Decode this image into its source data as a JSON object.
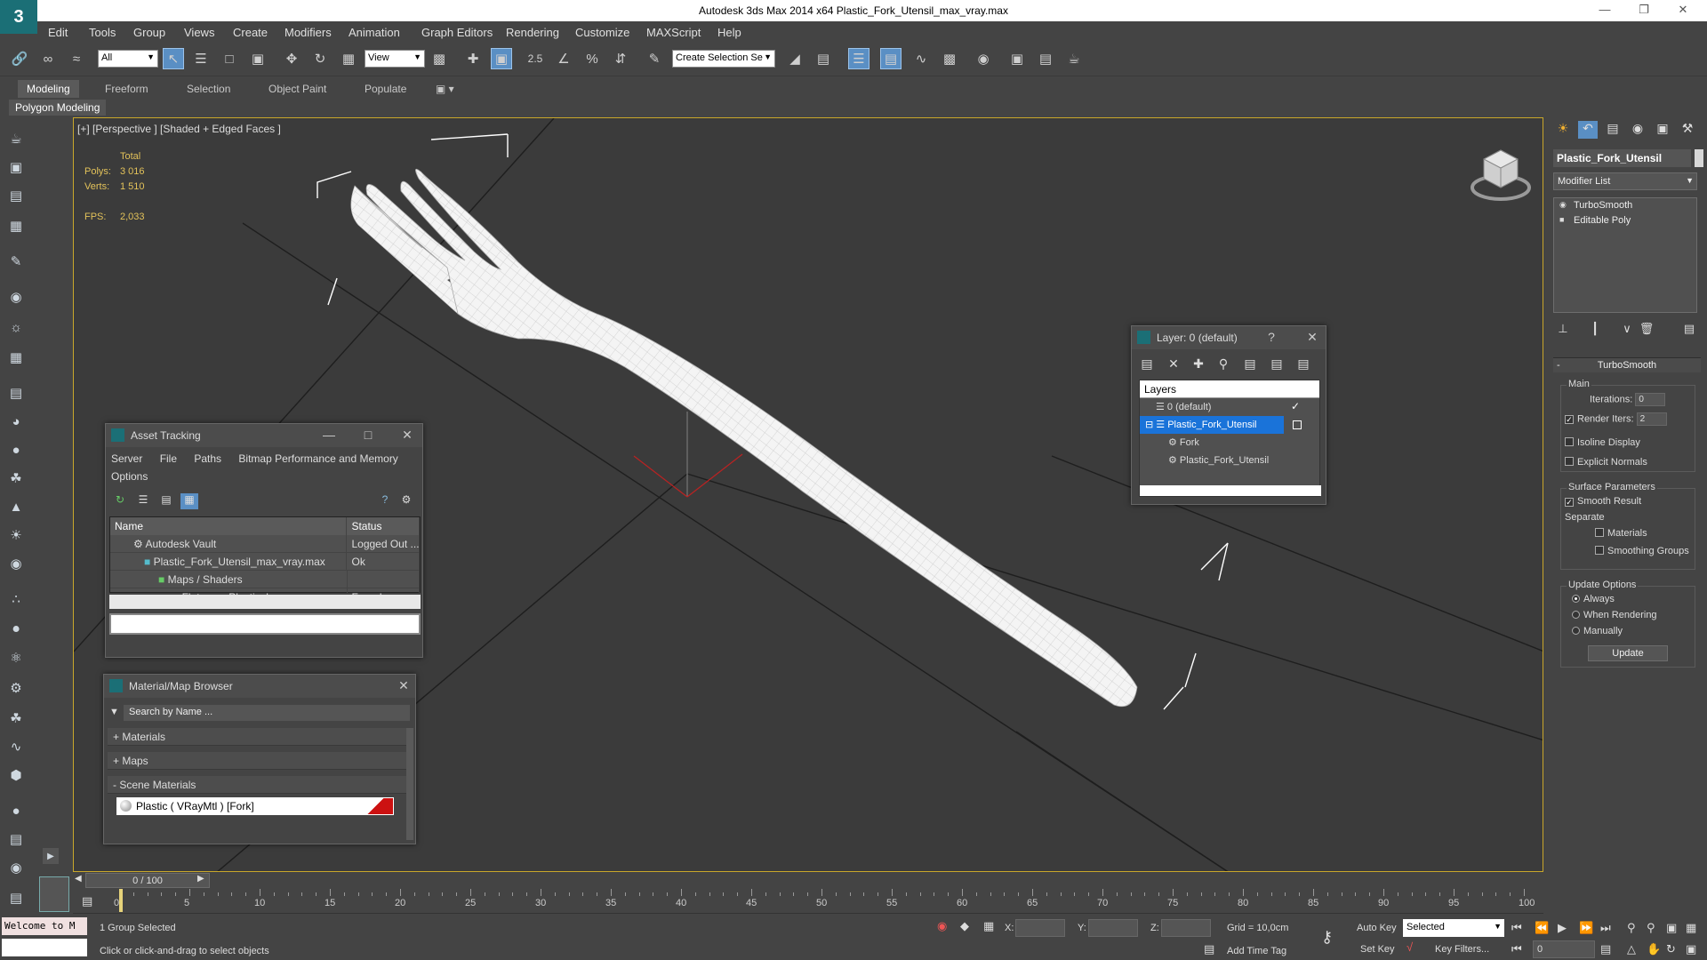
{
  "app": {
    "title": "Autodesk 3ds Max  2014 x64     Plastic_Fork_Utensil_max_vray.max"
  },
  "menu": [
    "Edit",
    "Tools",
    "Group",
    "Views",
    "Create",
    "Modifiers",
    "Animation",
    "Graph Editors",
    "Rendering",
    "Customize",
    "MAXScript",
    "Help"
  ],
  "toolbar": {
    "selection_filter": "All",
    "ref_coord": "View",
    "snap_label": "2.5",
    "named_selection_placeholder": "Create Selection Se"
  },
  "ribbon": {
    "tabs": [
      "Modeling",
      "Freeform",
      "Selection",
      "Object Paint",
      "Populate"
    ],
    "active_tab": "Modeling",
    "subpanel": "Polygon Modeling"
  },
  "viewport": {
    "label": "[+] [Perspective ] [Shaded + Edged Faces ]",
    "stats": {
      "total_label": "Total",
      "polys_label": "Polys:",
      "polys_value": "3 016",
      "verts_label": "Verts:",
      "verts_value": "1 510",
      "fps_label": "FPS:",
      "fps_value": "2,033"
    }
  },
  "command_panel": {
    "object_name": "Plastic_Fork_Utensil",
    "modifier_list": "Modifier List",
    "stack": [
      "TurboSmooth",
      "Editable Poly"
    ],
    "turbosmooth": {
      "title": "TurboSmooth",
      "main_label": "Main",
      "iterations_label": "Iterations:",
      "iterations_value": "0",
      "render_iters_label": "Render Iters:",
      "render_iters_value": "2",
      "isoline_label": "Isoline Display",
      "explicit_label": "Explicit Normals",
      "surface_label": "Surface Parameters",
      "smooth_result_label": "Smooth Result",
      "separate_label": "Separate",
      "materials_label": "Materials",
      "smoothing_groups_label": "Smoothing Groups",
      "update_options_label": "Update Options",
      "always_label": "Always",
      "when_rendering_label": "When Rendering",
      "manually_label": "Manually",
      "update_button": "Update"
    }
  },
  "asset_tracking": {
    "title": "Asset Tracking",
    "menu": [
      "Server",
      "File",
      "Paths",
      "Bitmap Performance and Memory"
    ],
    "menu2": "Options",
    "columns": [
      "Name",
      "Status"
    ],
    "rows": [
      {
        "name": "Autodesk Vault",
        "status": "Logged Out ..."
      },
      {
        "name": "Plastic_Fork_Utensil_max_vray.max",
        "status": "Ok"
      },
      {
        "name": "Maps / Shaders",
        "status": ""
      },
      {
        "name": "Flatware_Plastic_bump.png",
        "status": "Found"
      }
    ]
  },
  "material_browser": {
    "title": "Material/Map Browser",
    "search_placeholder": "Search by Name ...",
    "categories": [
      "+ Materials",
      "+ Maps",
      "- Scene Materials"
    ],
    "scene_material": "Plastic ( VRayMtl ) [Fork]"
  },
  "layer_dialog": {
    "title": "Layer: 0 (default)",
    "help": "?",
    "header": "Layers",
    "rows": [
      "0 (default)",
      "Plastic_Fork_Utensil",
      "Fork",
      "Plastic_Fork_Utensil"
    ]
  },
  "timeline": {
    "frame_display": "0 / 100",
    "ticks": [
      "0",
      "5",
      "10",
      "15",
      "20",
      "25",
      "30",
      "35",
      "40",
      "45",
      "50",
      "55",
      "60",
      "65",
      "70",
      "75",
      "80",
      "85",
      "90",
      "95",
      "100"
    ]
  },
  "status": {
    "maxscript_1": "Welcome to M",
    "maxscript_2": "",
    "selection": "1 Group Selected",
    "prompt": "Click or click-and-drag to select objects",
    "x_label": "X:",
    "y_label": "Y:",
    "z_label": "Z:",
    "grid": "Grid = 10,0cm",
    "add_time_tag": "Add Time Tag",
    "auto_key": "Auto Key",
    "set_key": "Set Key",
    "key_mode": "Selected",
    "key_filters": "Key Filters...",
    "current_frame": "0"
  }
}
